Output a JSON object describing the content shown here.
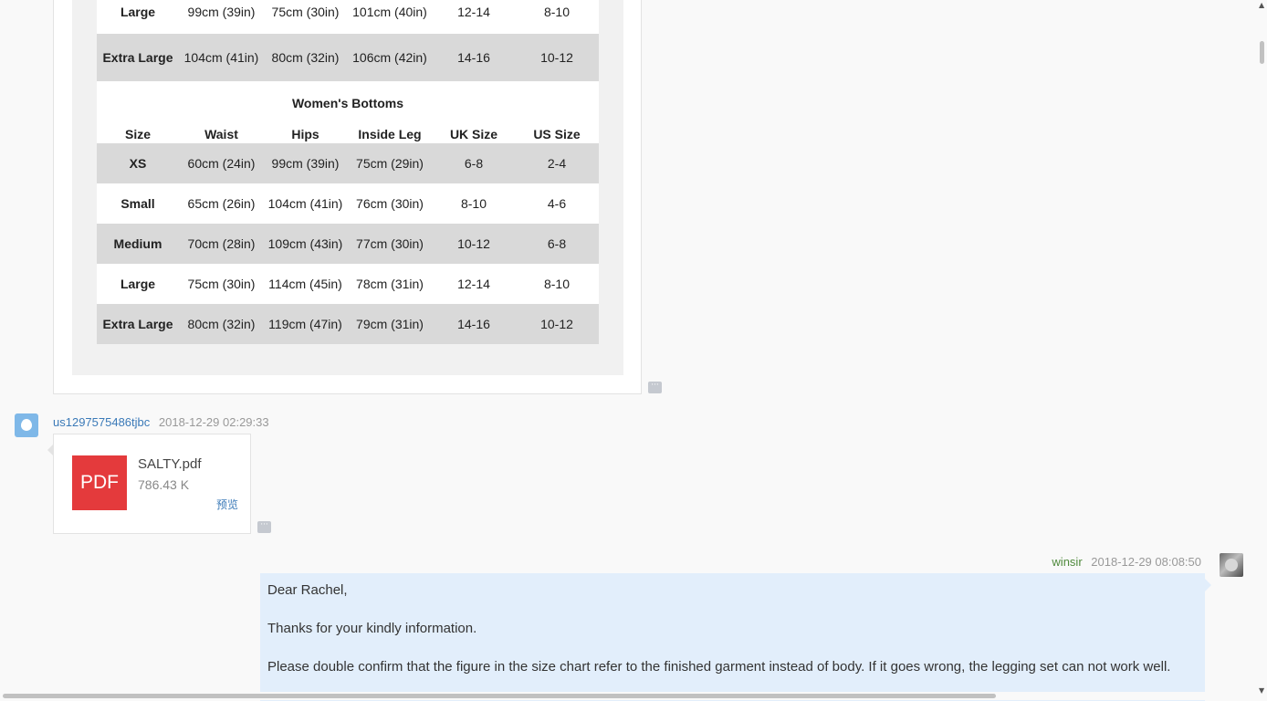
{
  "size_chart": {
    "top_rows": [
      {
        "size": "Large",
        "c1": "99cm (39in)",
        "c2": "75cm (30in)",
        "c3": "101cm (40in)",
        "uk": "12-14",
        "us": "8-10"
      },
      {
        "size": "Extra Large",
        "c1": "104cm (41in)",
        "c2": "80cm (32in)",
        "c3": "106cm (42in)",
        "uk": "14-16",
        "us": "10-12"
      }
    ],
    "womens_bottoms": {
      "title": "Women's Bottoms",
      "headers": [
        "Size",
        "Waist",
        "Hips",
        "Inside Leg",
        "UK Size",
        "US Size"
      ],
      "rows": [
        {
          "size": "XS",
          "waist": "60cm (24in)",
          "hips": "99cm (39in)",
          "leg": "75cm (29in)",
          "uk": "6-8",
          "us": "2-4"
        },
        {
          "size": "Small",
          "waist": "65cm (26in)",
          "hips": "104cm (41in)",
          "leg": "76cm (30in)",
          "uk": "8-10",
          "us": "4-6"
        },
        {
          "size": "Medium",
          "waist": "70cm (28in)",
          "hips": "109cm (43in)",
          "leg": "77cm (30in)",
          "uk": "10-12",
          "us": "6-8"
        },
        {
          "size": "Large",
          "waist": "75cm (30in)",
          "hips": "114cm (45in)",
          "leg": "78cm (31in)",
          "uk": "12-14",
          "us": "8-10"
        },
        {
          "size": "Extra Large",
          "waist": "80cm (32in)",
          "hips": "119cm (47in)",
          "leg": "79cm (31in)",
          "uk": "14-16",
          "us": "10-12"
        }
      ]
    }
  },
  "more_label": "···",
  "message_file": {
    "sender": "us1297575486tjbc",
    "time": "2018-12-29 02:29:33",
    "file_icon_label": "PDF",
    "file_name": "SALTY.pdf",
    "file_size": "786.43 K",
    "preview_label": "预览"
  },
  "message_reply": {
    "sender": "winsir",
    "time": "2018-12-29 08:08:50",
    "lines": [
      "Dear Rachel,",
      "Thanks for your kindly information.",
      "Please double confirm that the figure in the size chart refer to the finished garment instead of body.  If it goes wrong, the legging set can not work well."
    ]
  },
  "scrollbar": {
    "up_arrow": "▲",
    "down_arrow": "▼"
  }
}
